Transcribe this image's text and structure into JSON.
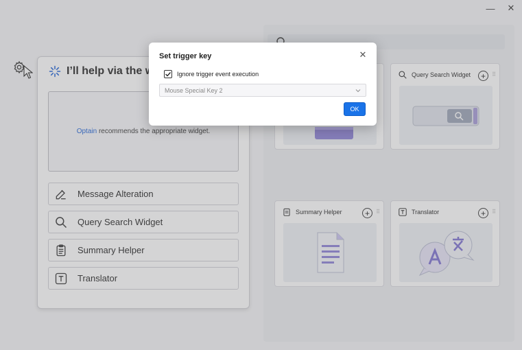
{
  "window": {
    "minimize_label": "—",
    "close_label": "✕"
  },
  "left_panel": {
    "header": "I’ll help via the wi",
    "recommend": {
      "brand": "Optain",
      "text": " recommends the appropriate widget."
    },
    "items": [
      {
        "label": "Message Alteration",
        "icon": "edit-icon"
      },
      {
        "label": "Query Search Widget",
        "icon": "search-icon"
      },
      {
        "label": "Summary Helper",
        "icon": "clipboard-icon"
      },
      {
        "label": "Translator",
        "icon": "translator-icon"
      }
    ]
  },
  "cards": [
    {
      "title": "Query Search Widget",
      "icon": "search-icon",
      "add": "+",
      "more": "⠿"
    },
    {
      "title": "Summary Helper",
      "icon": "clipboard-icon",
      "add": "+",
      "more": "⠿"
    },
    {
      "title": "Translator",
      "icon": "translator-icon",
      "add": "+",
      "more": "⠿"
    }
  ],
  "dialog": {
    "title": "Set trigger key",
    "close": "✕",
    "checkbox_label": "Ignore trigger event execution",
    "checkbox_checked": true,
    "select_value": "Mouse Special Key 2",
    "ok_label": "OK"
  },
  "colors": {
    "accent": "#1a73e8",
    "brand_link": "#1a5fd6"
  }
}
